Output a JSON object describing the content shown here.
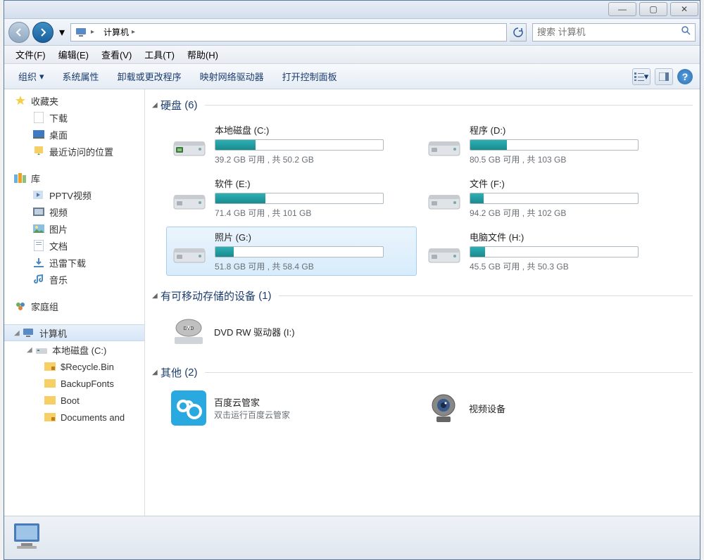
{
  "titlebar": {
    "minimize": "—",
    "maximize": "▢",
    "close": "✕"
  },
  "nav": {
    "path_label": "计算机",
    "search_placeholder": "搜索 计算机"
  },
  "menubar": [
    "文件(F)",
    "编辑(E)",
    "查看(V)",
    "工具(T)",
    "帮助(H)"
  ],
  "toolbar": {
    "organize": "组织",
    "props": "系统属性",
    "uninstall": "卸载或更改程序",
    "mapdrive": "映射网络驱动器",
    "controlpanel": "打开控制面板"
  },
  "sidebar": {
    "favorites": {
      "label": "收藏夹",
      "items": [
        "下载",
        "桌面",
        "最近访问的位置"
      ]
    },
    "libraries": {
      "label": "库",
      "items": [
        "PPTV视频",
        "视频",
        "图片",
        "文档",
        "迅雷下载",
        "音乐"
      ]
    },
    "homegroup": {
      "label": "家庭组"
    },
    "computer": {
      "label": "计算机",
      "items": [
        "本地磁盘 (C:)",
        "$Recycle.Bin",
        "BackupFonts",
        "Boot",
        "Documents and"
      ]
    }
  },
  "categories": {
    "hd": {
      "label": "硬盘",
      "count": "(6)"
    },
    "removable": {
      "label": "有可移动存储的设备",
      "count": "(1)"
    },
    "other": {
      "label": "其他",
      "count": "(2)"
    }
  },
  "drives": [
    {
      "name": "本地磁盘 (C:)",
      "free": "39.2 GB 可用 ,  共 50.2 GB",
      "pct": 24,
      "sys": true
    },
    {
      "name": "程序 (D:)",
      "free": "80.5 GB 可用 ,  共 103 GB",
      "pct": 22
    },
    {
      "name": "软件 (E:)",
      "free": "71.4 GB 可用 ,  共 101 GB",
      "pct": 30
    },
    {
      "name": "文件 (F:)",
      "free": "94.2 GB 可用 ,  共 102 GB",
      "pct": 8
    },
    {
      "name": "照片 (G:)",
      "free": "51.8 GB 可用 ,  共 58.4 GB",
      "pct": 11,
      "sel": true
    },
    {
      "name": "电脑文件 (H:)",
      "free": "45.5 GB 可用 ,  共 50.3 GB",
      "pct": 9
    }
  ],
  "removable": [
    {
      "name": "DVD RW 驱动器 (I:)"
    }
  ],
  "other": [
    {
      "name": "百度云管家",
      "sub": "双击运行百度云管家",
      "icon": "bdy"
    },
    {
      "name": "视频设备",
      "icon": "webcam"
    }
  ]
}
